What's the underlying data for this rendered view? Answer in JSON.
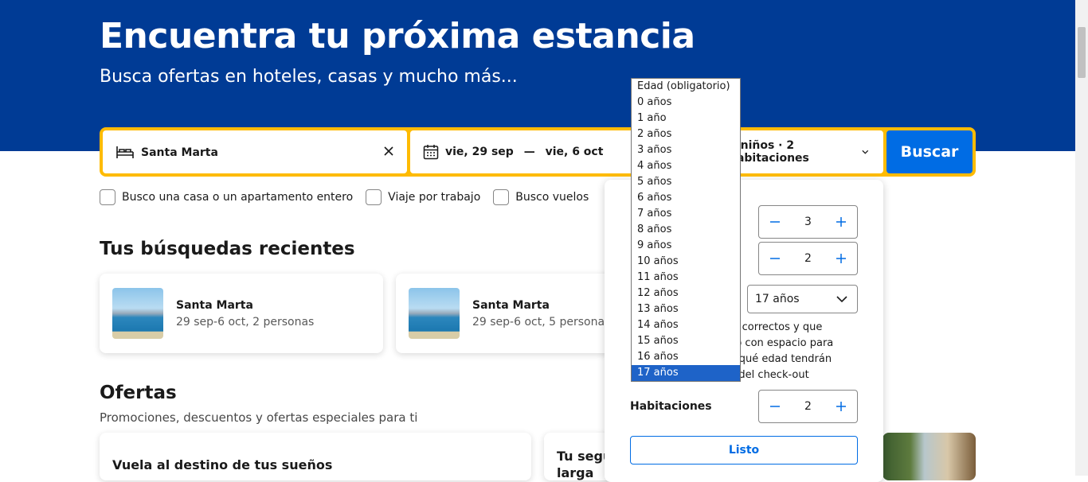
{
  "hero": {
    "title": "Encuentra tu próxima estancia",
    "subtitle": "Busca ofertas en hoteles, casas y mucho más..."
  },
  "search": {
    "destination": "Santa Marta",
    "date_start": "vie, 29 sep",
    "date_sep": "—",
    "date_end": "vie, 6 oct",
    "occupancy": "2 niños · 2 habitaciones",
    "search_button": "Buscar"
  },
  "checkboxes": [
    {
      "label": "Busco una casa o un apartamento entero"
    },
    {
      "label": "Viaje por trabajo"
    },
    {
      "label": "Busco vuelos"
    }
  ],
  "recent": {
    "title": "Tus búsquedas recientes",
    "items": [
      {
        "title": "Santa Marta",
        "subtitle": "29 sep-6 oct, 2 personas"
      },
      {
        "title": "Santa Marta",
        "subtitle": "29 sep-6 oct, 5 personas"
      }
    ]
  },
  "offers": {
    "title": "Ofertas",
    "subtitle": "Promociones, descuentos y ofertas especiales para ti",
    "items": [
      {
        "title": "Vuela al destino de tus sueños"
      },
      {
        "title": "Tu segur",
        "title2": "larga"
      }
    ]
  },
  "occupancy_panel": {
    "adults_value": "3",
    "children_value": "2",
    "child_age_value": "17 años",
    "note_lines": [
      "cios correctos y que",
      "ento con espacio para",
      "per qué edad tendrán",
      "nto del check-out"
    ],
    "rooms_label": "Habitaciones",
    "rooms_value": "2",
    "done_button": "Listo"
  },
  "age_dropdown": {
    "options": [
      "Edad (obligatorio)",
      "0 años",
      "1 año",
      "2 años",
      "3 años",
      "4 años",
      "5 años",
      "6 años",
      "7 años",
      "8 años",
      "9 años",
      "10 años",
      "11 años",
      "12 años",
      "13 años",
      "14 años",
      "15 años",
      "16 años",
      "17 años"
    ],
    "selected": "17 años"
  },
  "colors": {
    "brand_blue": "#003b95",
    "accent_yellow": "#febb02",
    "button_blue": "#006ce4",
    "selection_blue": "#1e63c8"
  }
}
